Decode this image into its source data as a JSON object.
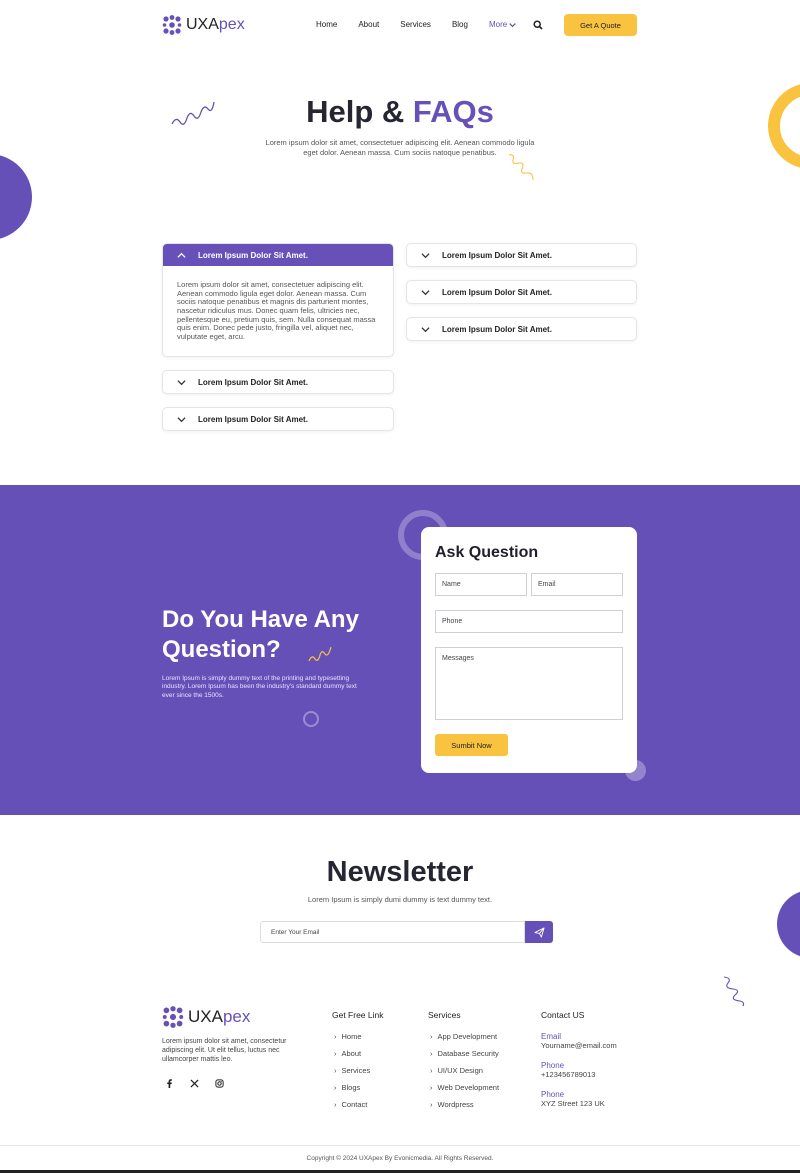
{
  "header": {
    "brand_main": "UXA",
    "brand_accent": "pex",
    "nav": [
      "Home",
      "About",
      "Services",
      "Blog"
    ],
    "nav_more": "More",
    "cta": "Get A Quote"
  },
  "hero": {
    "title_main": "Help &",
    "title_accent": "FAQs",
    "subtitle": "Lorem ipsum dolor sit amet, consectetuer adipiscing elit. Aenean commodo ligula eget dolor. Aenean massa. Cum sociis natoque penatibus."
  },
  "faq": {
    "left": [
      {
        "q": "Lorem Ipsum Dolor Sit Amet.",
        "open": true,
        "a": "Lorem ipsum dolor sit amet, consectetuer adipiscing elit. Aenean commodo ligula eget dolor. Aenean massa. Cum sociis natoque penatibus et magnis dis parturient montes, nascetur ridiculus mus. Donec quam felis, ultricies nec, pellentesque eu, pretium quis, sem. Nulla consequat massa quis enim. Donec pede justo, fringilla vel, aliquet nec, vulputate eget, arcu."
      },
      {
        "q": "Lorem Ipsum Dolor Sit Amet."
      },
      {
        "q": "Lorem Ipsum Dolor Sit Amet."
      }
    ],
    "right": [
      {
        "q": "Lorem Ipsum Dolor Sit Amet."
      },
      {
        "q": "Lorem Ipsum Dolor Sit Amet."
      },
      {
        "q": "Lorem Ipsum Dolor Sit Amet."
      }
    ]
  },
  "question": {
    "title_line1": "Do You Have Any",
    "title_line2": "Question?",
    "text": "Lorem Ipsum is simply dummy text of the printing and typesetting industry. Lorem Ipsum has been the industry's standard dummy text ever since the 1500s.",
    "form": {
      "title": "Ask Question",
      "name_placeholder": "Name",
      "email_placeholder": "Email",
      "phone_placeholder": "Phone",
      "message_placeholder": "Messages",
      "submit": "Sumbit Now"
    }
  },
  "newsletter": {
    "title": "Newsletter",
    "subtitle": "Lorem Ipsum is simply dumi dummy is text dummy text.",
    "placeholder": "Enter Your Email"
  },
  "footer": {
    "brand_main": "UXA",
    "brand_accent": "pex",
    "description": "Lorem ipsum dolor sit amet, consectetur adipiscing elit. Ut elit tellus, luctus nec ullamcorper mattis leo.",
    "links_title": "Get Free Link",
    "links": [
      "Home",
      "About",
      "Services",
      "Blogs",
      "Contact"
    ],
    "services_title": "Services",
    "services": [
      "App Development",
      "Database Security",
      "UI/UX Design",
      "Web Development",
      "Wordpress"
    ],
    "contact_title": "Contact US",
    "contacts": [
      {
        "label": "Email",
        "value": "Yourname@email.com"
      },
      {
        "label": "Phone",
        "value": "+123456789013"
      },
      {
        "label": "Phone",
        "value": "XYZ Street 123 UK"
      }
    ],
    "copyright": "Copyright © 2024 UXApex By Evonicmedia. All Rights Reserved."
  },
  "colors": {
    "primary": "#6550b8",
    "accent": "#f9c33f",
    "dark": "#262633"
  },
  "icons": [
    "logo-icon",
    "chevron-down-icon",
    "search-icon",
    "chevron-up-icon",
    "send-icon",
    "facebook-icon",
    "x-icon",
    "instagram-icon",
    "chevron-right-icon"
  ]
}
